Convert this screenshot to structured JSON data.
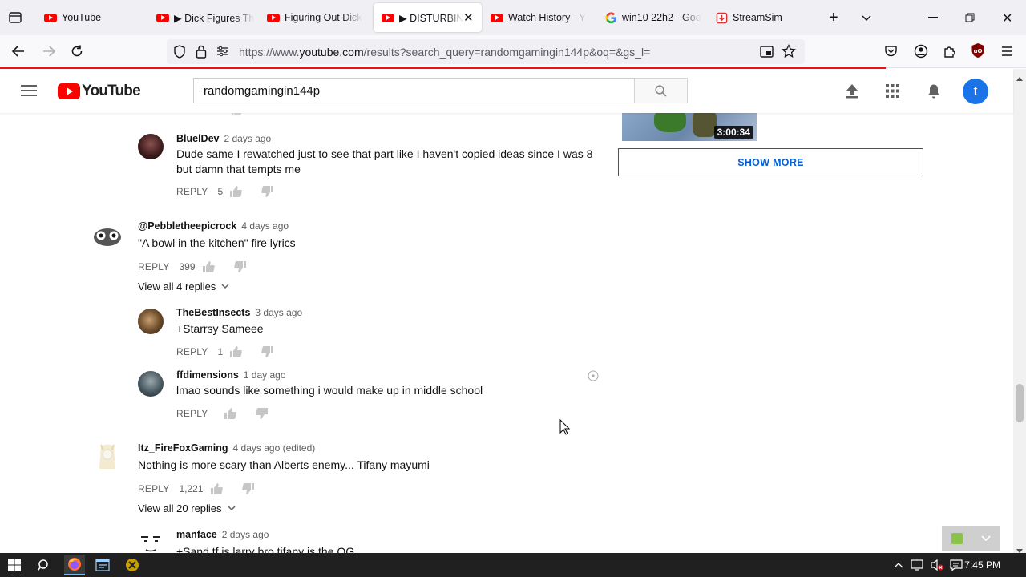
{
  "browser": {
    "tabs": [
      {
        "label": "YouTube",
        "favicon": "youtube-icon"
      },
      {
        "label": "▶ Dick Figures Th",
        "favicon": "youtube-icon"
      },
      {
        "label": "Figuring Out Dick",
        "favicon": "youtube-icon"
      },
      {
        "label": "▶ DISTURBING",
        "favicon": "youtube-icon",
        "active": true
      },
      {
        "label": "Watch History - Y",
        "favicon": "youtube-icon"
      },
      {
        "label": "win10 22h2 - Goo",
        "favicon": "google-icon"
      },
      {
        "label": "StreamSim",
        "favicon": "streamsim-icon"
      }
    ],
    "url_prefix": "https://www.",
    "url_domain": "youtube.com",
    "url_rest": "/results?search_query=randomgamingin144p&oq=&gs_l="
  },
  "youtube": {
    "logo_text": "YouTube",
    "search_value": "randomgamingin144p",
    "avatar_letter": "t",
    "colors": {
      "brand": "#ff0000",
      "link": "#065fd4",
      "avatar": "#1a73e8"
    }
  },
  "sidebar": {
    "video_duration": "3:00:34",
    "show_more": "SHOW MORE"
  },
  "comments": [
    {
      "author": "BluelDev",
      "time": "2 days ago",
      "text": "Dude same I rewatched just to see that part like I haven't copied ideas since I was 8 but damn that tempts me",
      "reply": "REPLY",
      "likes": "5"
    },
    {
      "author": "@Pebbletheepicrock",
      "time": "4 days ago",
      "text": "\"A bowl in the kitchen\" fire lyrics",
      "reply": "REPLY",
      "likes": "399",
      "view_replies": "View all 4 replies"
    },
    {
      "author": "TheBestInsects",
      "time": "3 days ago",
      "text": "+Starrsy Sameee",
      "reply": "REPLY",
      "likes": "1"
    },
    {
      "author": "ffdimensions",
      "time": "1 day ago",
      "text": "lmao sounds like something i would make up in middle school",
      "reply": "REPLY",
      "likes": ""
    },
    {
      "author": "Itz_FireFoxGaming",
      "time": "4 days ago (edited)",
      "text": "Nothing is more scary than Alberts enemy... Tifany mayumi",
      "reply": "REPLY",
      "likes": "1,221",
      "view_replies": "View all 20 replies"
    },
    {
      "author": "manface",
      "time": "2 days ago",
      "text": "+Sand tf is larry bro tifany is the OG",
      "reply": "REPLY",
      "likes": ""
    }
  ],
  "taskbar": {
    "time": "7:45 PM"
  }
}
